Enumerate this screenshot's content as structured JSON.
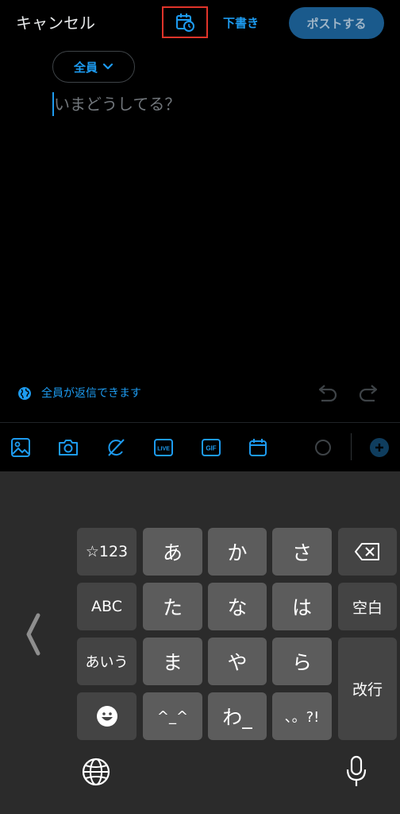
{
  "header": {
    "cancel_label": "キャンセル",
    "schedule_icon": "calendar-clock-icon",
    "drafts_label": "下書き",
    "post_label": "ポストする"
  },
  "composer": {
    "audience_label": "全員",
    "placeholder": "いまどうしてる？"
  },
  "reply_setting": {
    "icon": "globe-icon",
    "label": "全員が返信できます"
  },
  "toolbar": {
    "items": [
      "image-icon",
      "camera-icon",
      "grok-icon",
      "live-icon",
      "gif-icon",
      "schedule-icon"
    ],
    "live_text": "LIVE",
    "gif_text": "GIF"
  },
  "keyboard": {
    "keys": {
      "num": "☆123",
      "abc": "ABC",
      "kana_mode": "あいう",
      "a": "あ",
      "ka": "か",
      "sa": "さ",
      "ta": "た",
      "na": "な",
      "ha": "は",
      "ma": "ま",
      "ya": "や",
      "ra": "ら",
      "dakuten": "^_^",
      "wa": "わ_",
      "punct": "、。?!",
      "space": "空白",
      "enter": "改行"
    }
  },
  "colors": {
    "accent": "#1d9bf0",
    "post_button_bg": "#1a5a8c",
    "highlight_box": "#e0342a",
    "keyboard_bg": "#2b2b2b",
    "key_bg": "#5c5c5c",
    "fn_key_bg": "#444444"
  }
}
